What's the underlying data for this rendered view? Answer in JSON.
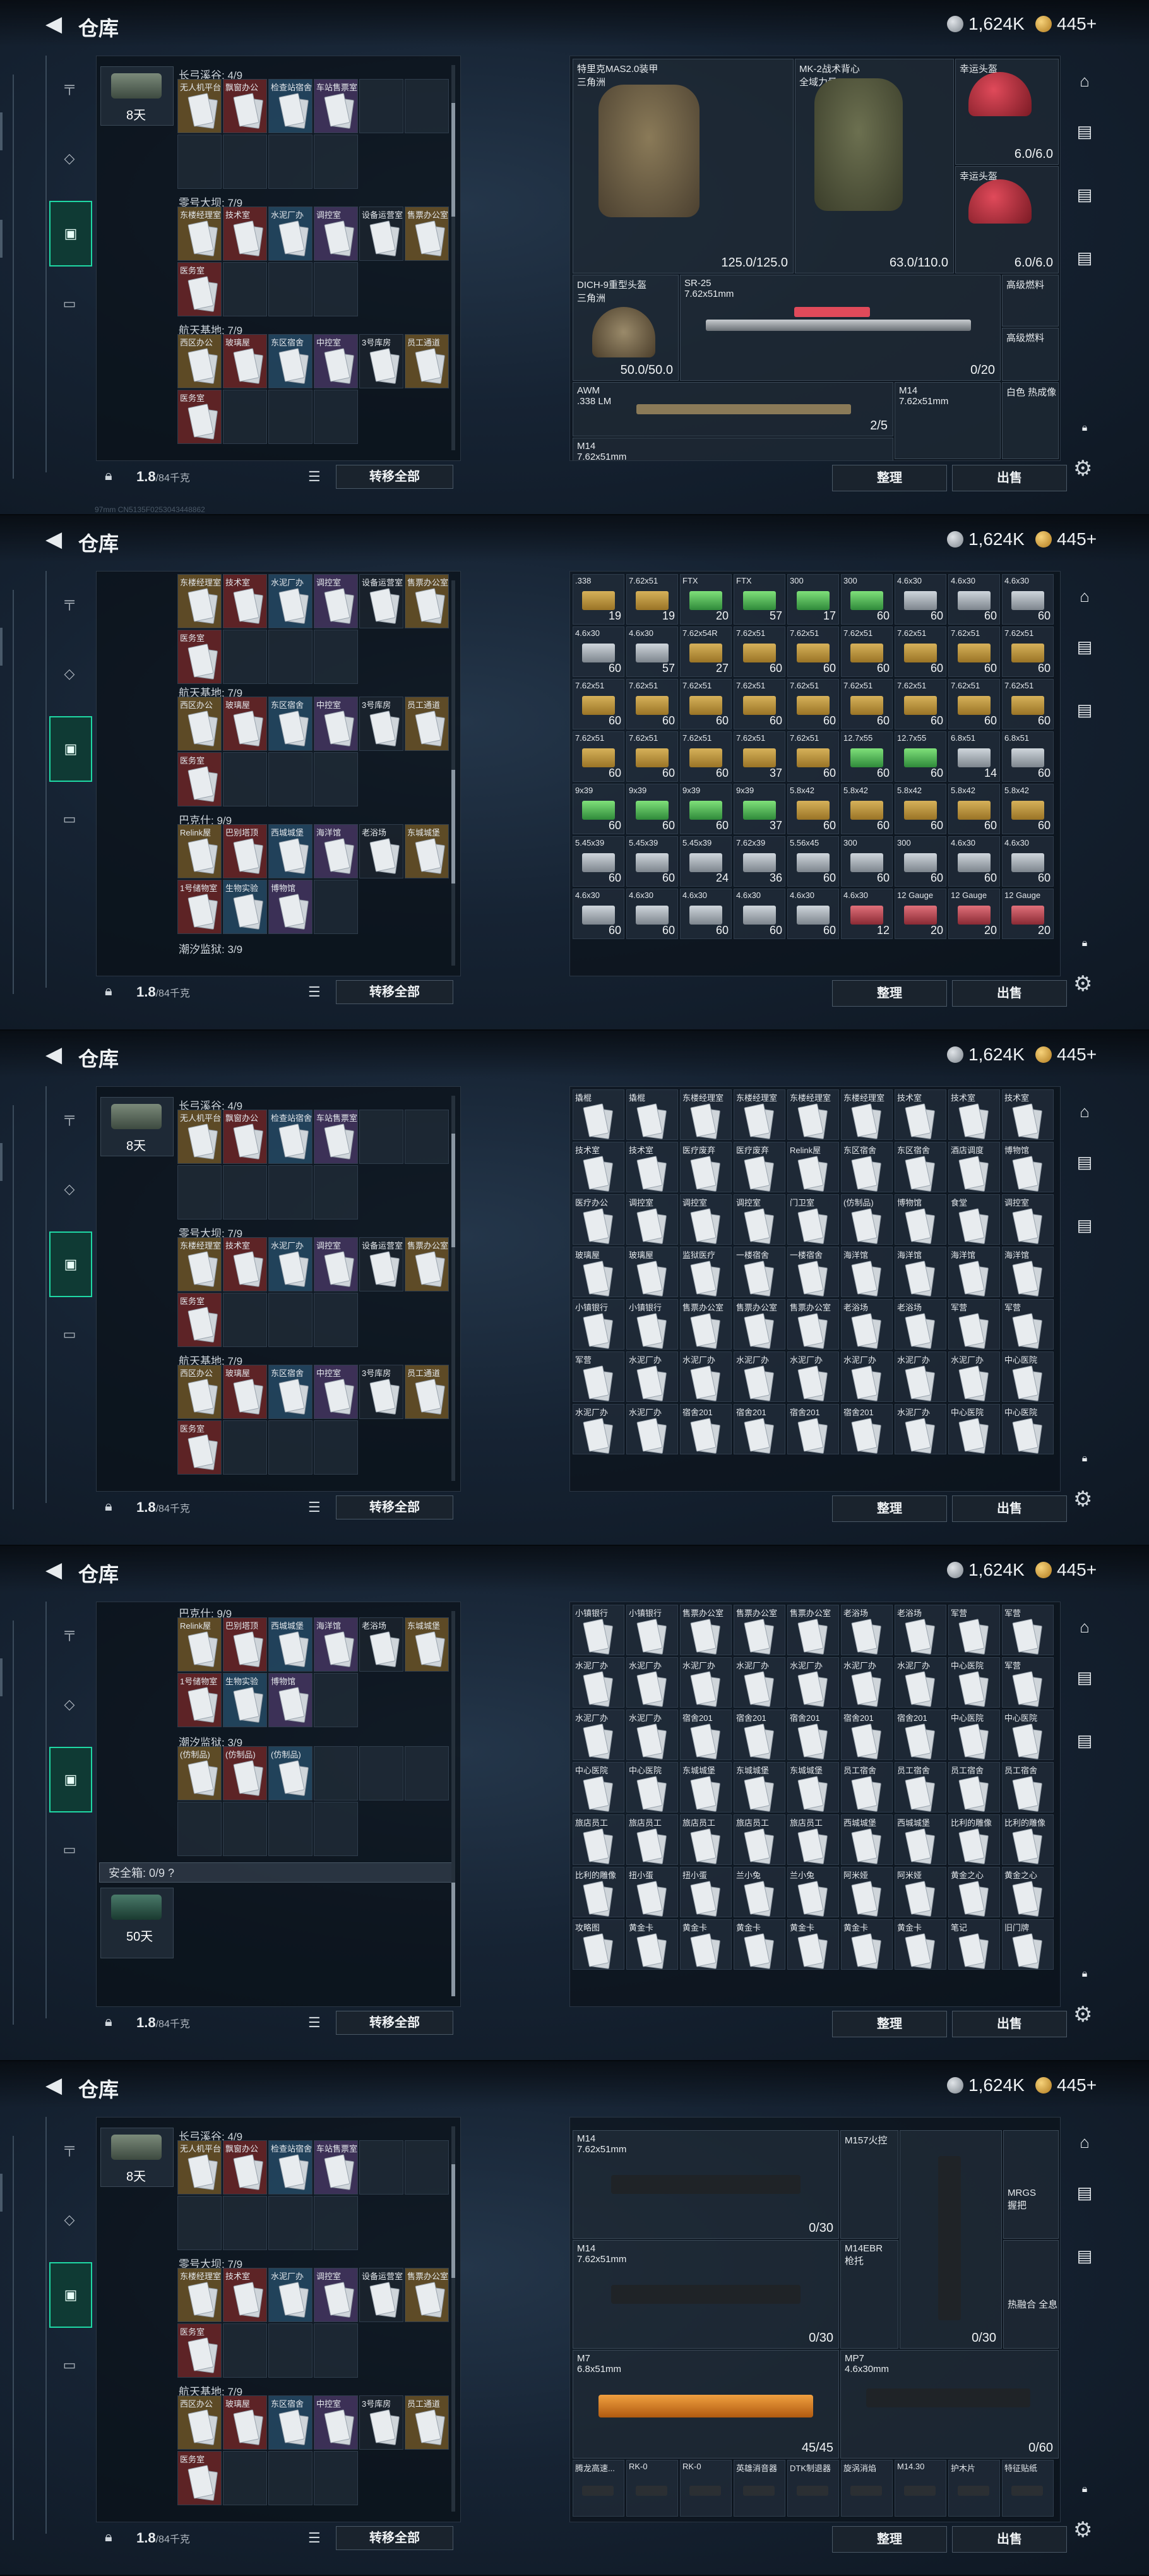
{
  "header": {
    "title": "仓库",
    "silver": "1,624K",
    "gold": "445+"
  },
  "left": {
    "weight": "1.8",
    "weight_cap": "/84千克",
    "transfer_label": "转移全部",
    "p1_sections": [
      {
        "title": "长弓溪谷: 4/9",
        "cells": [
          "无人机平台",
          "飘窗办公",
          "检查站宿舍",
          "车站售票室"
        ]
      },
      {
        "title": "零号大坝: 7/9",
        "cells": [
          "东楼经理室",
          "技术室",
          "水泥厂办",
          "调控室",
          "设备运营室",
          "售票办公室",
          "医务室"
        ]
      },
      {
        "title": "航天基地: 7/9",
        "cells": [
          "西区办公",
          "玻璃屋",
          "东区宿舍",
          "中控室",
          "3号库房",
          "员工通道",
          "医务室"
        ]
      }
    ],
    "p2_sections": [
      {
        "title": "航天基地: 7/9",
        "cells": [
          "西区办公",
          "玻璃屋",
          "东区宿舍",
          "中控室",
          "3号库房",
          "员工通道",
          "医务室"
        ]
      },
      {
        "title": "巴克什: 9/9",
        "cells": [
          "Relink屋",
          "巴别塔顶",
          "西城城堡",
          "海洋馆",
          "老浴场",
          "东城城堡",
          "1号储物室",
          "生物实验",
          "博物馆"
        ]
      },
      {
        "title": "潮汐监狱: 3/9",
        "cells": [
          "(仿制品)",
          "(仿制品)",
          "(仿制品)"
        ]
      }
    ],
    "p4_sections": [
      {
        "title": "巴克什: 9/9",
        "cells": [
          "Relink屋",
          "巴别塔顶",
          "西城城堡",
          "海洋馆",
          "老浴场",
          "东城城堡",
          "1号储物室",
          "生物实验",
          "博物馆"
        ]
      },
      {
        "title": "潮汐监狱: 3/9",
        "cells": [
          "(仿制品)",
          "(仿制品)",
          "(仿制品)"
        ]
      }
    ],
    "case_days": "8天",
    "safe_title": "安全箱: 0/9 ?",
    "safe_days": "50天"
  },
  "right": {
    "sort_label": "整理",
    "sell_label": "出售",
    "equipment": {
      "armor1": {
        "name": "特里克MAS2.0装甲\n三角洲",
        "val": "125.0/125.0"
      },
      "armor2": {
        "name": "MK-2战术背心\n全域力量",
        "val": "63.0/110.0"
      },
      "helm1": {
        "name": "幸运头盔",
        "val": "6.0/6.0"
      },
      "helm2": {
        "name": "幸运头盔",
        "val": "6.0/6.0"
      },
      "helmet3": {
        "name": "DICH-9重型头盔\n三角洲",
        "val": "50.0/50.0"
      },
      "sr25": {
        "name": "SR-25\n7.62x51mm",
        "val": "0/20"
      },
      "fuel": {
        "name": "高级燃料"
      },
      "fuel2": {
        "name": "高级燃料"
      },
      "awm": {
        "name": "AWM\n.338 LM",
        "val": "2/5"
      },
      "m14": {
        "name": "M14\n7.62x51mm"
      },
      "m14b": {
        "name": "M14\n7.62x51mm"
      },
      "m157": {
        "name": "M157火控"
      },
      "bag": {
        "name": "白色 热成像"
      }
    },
    "ammo_grid": [
      {
        "n": ".338",
        "q": "19",
        "c": "gold"
      },
      {
        "n": "7.62x51",
        "q": "19",
        "c": "gold"
      },
      {
        "n": "FTX",
        "q": "20",
        "c": "green"
      },
      {
        "n": "FTX",
        "q": "57",
        "c": "green"
      },
      {
        "n": "300",
        "q": "17",
        "c": "green"
      },
      {
        "n": "300",
        "q": "60",
        "c": "green"
      },
      {
        "n": "4.6x30",
        "q": "60",
        "c": "silver"
      },
      {
        "n": "4.6x30",
        "q": "60",
        "c": "silver"
      },
      {
        "n": "4.6x30",
        "q": "60",
        "c": "silver"
      },
      {
        "n": "4.6x30",
        "q": "60",
        "c": "silver"
      },
      {
        "n": "4.6x30",
        "q": "57",
        "c": "silver"
      },
      {
        "n": "7.62x54R",
        "q": "27",
        "c": "gold"
      },
      {
        "n": "7.62x51",
        "q": "60",
        "c": "gold"
      },
      {
        "n": "7.62x51",
        "q": "60",
        "c": "gold"
      },
      {
        "n": "7.62x51",
        "q": "60",
        "c": "gold"
      },
      {
        "n": "7.62x51",
        "q": "60",
        "c": "gold"
      },
      {
        "n": "7.62x51",
        "q": "60",
        "c": "gold"
      },
      {
        "n": "7.62x51",
        "q": "60",
        "c": "gold"
      },
      {
        "n": "7.62x51",
        "q": "60",
        "c": "gold"
      },
      {
        "n": "7.62x51",
        "q": "60",
        "c": "gold"
      },
      {
        "n": "7.62x51",
        "q": "60",
        "c": "gold"
      },
      {
        "n": "7.62x51",
        "q": "60",
        "c": "gold"
      },
      {
        "n": "7.62x51",
        "q": "60",
        "c": "gold"
      },
      {
        "n": "7.62x51",
        "q": "60",
        "c": "gold"
      },
      {
        "n": "7.62x51",
        "q": "60",
        "c": "gold"
      },
      {
        "n": "7.62x51",
        "q": "60",
        "c": "gold"
      },
      {
        "n": "7.62x51",
        "q": "60",
        "c": "gold"
      },
      {
        "n": "7.62x51",
        "q": "60",
        "c": "gold"
      },
      {
        "n": "7.62x51",
        "q": "60",
        "c": "gold"
      },
      {
        "n": "7.62x51",
        "q": "60",
        "c": "gold"
      },
      {
        "n": "7.62x51",
        "q": "37",
        "c": "gold"
      },
      {
        "n": "7.62x51",
        "q": "60",
        "c": "gold"
      },
      {
        "n": "12.7x55",
        "q": "60",
        "c": "green"
      },
      {
        "n": "12.7x55",
        "q": "60",
        "c": "green"
      },
      {
        "n": "6.8x51",
        "q": "14",
        "c": "silver"
      },
      {
        "n": "6.8x51",
        "q": "60",
        "c": "silver"
      },
      {
        "n": "9x39",
        "q": "60",
        "c": "green"
      },
      {
        "n": "9x39",
        "q": "60",
        "c": "green"
      },
      {
        "n": "9x39",
        "q": "60",
        "c": "green"
      },
      {
        "n": "9x39",
        "q": "37",
        "c": "green"
      },
      {
        "n": "5.8x42",
        "q": "60",
        "c": "gold"
      },
      {
        "n": "5.8x42",
        "q": "60",
        "c": "gold"
      },
      {
        "n": "5.8x42",
        "q": "60",
        "c": "gold"
      },
      {
        "n": "5.8x42",
        "q": "60",
        "c": "gold"
      },
      {
        "n": "5.8x42",
        "q": "60",
        "c": "gold"
      },
      {
        "n": "5.45x39",
        "q": "60",
        "c": "silver"
      },
      {
        "n": "5.45x39",
        "q": "60",
        "c": "silver"
      },
      {
        "n": "5.45x39",
        "q": "24",
        "c": "silver"
      },
      {
        "n": "7.62x39",
        "q": "36",
        "c": "silver"
      },
      {
        "n": "5.56x45",
        "q": "60",
        "c": "silver"
      },
      {
        "n": "300",
        "q": "60",
        "c": "silver"
      },
      {
        "n": "300",
        "q": "60",
        "c": "silver"
      },
      {
        "n": "4.6x30",
        "q": "60",
        "c": "silver"
      },
      {
        "n": "4.6x30",
        "q": "60",
        "c": "silver"
      },
      {
        "n": "4.6x30",
        "q": "60",
        "c": "silver"
      },
      {
        "n": "4.6x30",
        "q": "60",
        "c": "silver"
      },
      {
        "n": "4.6x30",
        "q": "60",
        "c": "silver"
      },
      {
        "n": "4.6x30",
        "q": "60",
        "c": "silver"
      },
      {
        "n": "4.6x30",
        "q": "60",
        "c": "silver"
      },
      {
        "n": "4.6x30",
        "q": "12",
        "c": "red"
      },
      {
        "n": "12 Gauge",
        "q": "20",
        "c": "red"
      },
      {
        "n": "12 Gauge",
        "q": "20",
        "c": "red"
      },
      {
        "n": "12 Gauge",
        "q": "20",
        "c": "red"
      }
    ],
    "card_grid": [
      "撬棍",
      "撬棍",
      "东楼经理室",
      "东楼经理室",
      "东楼经理室",
      "东楼经理室",
      "技术室",
      "技术室",
      "技术室",
      "技术室",
      "技术室",
      "医疗废弃",
      "医疗废弃",
      "Relink屋",
      "东区宿舍",
      "东区宿舍",
      "酒店调度",
      "博物馆",
      "医疗办公",
      "调控室",
      "调控室",
      "调控室",
      "门卫室",
      "(仿制品)",
      "博物馆",
      "食堂",
      "调控室",
      "玻璃屋",
      "玻璃屋",
      "监狱医疗",
      "一楼宿舍",
      "一楼宿舍",
      "海洋馆",
      "海洋馆",
      "海洋馆",
      "海洋馆",
      "小镇银行",
      "小镇银行",
      "售票办公室",
      "售票办公室",
      "售票办公室",
      "老浴场",
      "老浴场",
      "军营",
      "军营",
      "军营",
      "水泥厂办",
      "水泥厂办",
      "水泥厂办",
      "水泥厂办",
      "水泥厂办",
      "水泥厂办",
      "水泥厂办",
      "中心医院",
      "水泥厂办",
      "水泥厂办",
      "宿舍201",
      "宿舍201",
      "宿舍201",
      "宿舍201",
      "水泥厂办",
      "中心医院",
      "中心医院"
    ],
    "card_grid2": [
      "小镇银行",
      "小镇银行",
      "售票办公室",
      "售票办公室",
      "售票办公室",
      "老浴场",
      "老浴场",
      "军营",
      "军营",
      "水泥厂办",
      "水泥厂办",
      "水泥厂办",
      "水泥厂办",
      "水泥厂办",
      "水泥厂办",
      "水泥厂办",
      "中心医院",
      "军营",
      "水泥厂办",
      "水泥厂办",
      "宿舍201",
      "宿舍201",
      "宿舍201",
      "宿舍201",
      "宿舍201",
      "中心医院",
      "中心医院",
      "中心医院",
      "中心医院",
      "东城城堡",
      "东城城堡",
      "东城城堡",
      "员工宿舍",
      "员工宿舍",
      "员工宿舍",
      "员工宿舍",
      "旅店员工",
      "旅店员工",
      "旅店员工",
      "旅店员工",
      "旅店员工",
      "西城城堡",
      "西城城堡",
      "比利的雕像",
      "比利的雕像",
      "比利的雕像",
      "扭小蛋",
      "扭小蛋",
      "兰小兔",
      "兰小兔",
      "阿米娅",
      "阿米娅",
      "黄金之心",
      "黄金之心",
      "攻略图",
      "黄金卡",
      "黄金卡",
      "黄金卡",
      "黄金卡",
      "黄金卡",
      "黄金卡",
      "笔记",
      "旧门牌"
    ],
    "weapons": {
      "g1": {
        "name": "M14\n7.62x51mm",
        "val": "0/30"
      },
      "g2": {
        "name": "M14\n7.62x51mm",
        "val": "0/30"
      },
      "g3": {
        "name": "M7\n6.8x51mm",
        "val": "45/45"
      },
      "g4": {
        "name": "MP7\n4.6x30mm",
        "val": "0/60"
      },
      "g5": {
        "name": "M157火控",
        "val": "2/5"
      },
      "g6": {
        "name": "M14EBR\n枪托",
        "val": "0/30"
      },
      "g7": {
        "name": "MRGS\n握把"
      },
      "g8": {
        "name": "热融合 全息"
      },
      "att": [
        "腾龙高速...",
        "RK-0",
        "RK-0",
        "英雄消音器",
        "DTK制退器",
        "旋涡消焰",
        "M14.30",
        "护木片",
        "特征贴纸"
      ]
    }
  },
  "status": "97mm  CN5135F0253043448862"
}
